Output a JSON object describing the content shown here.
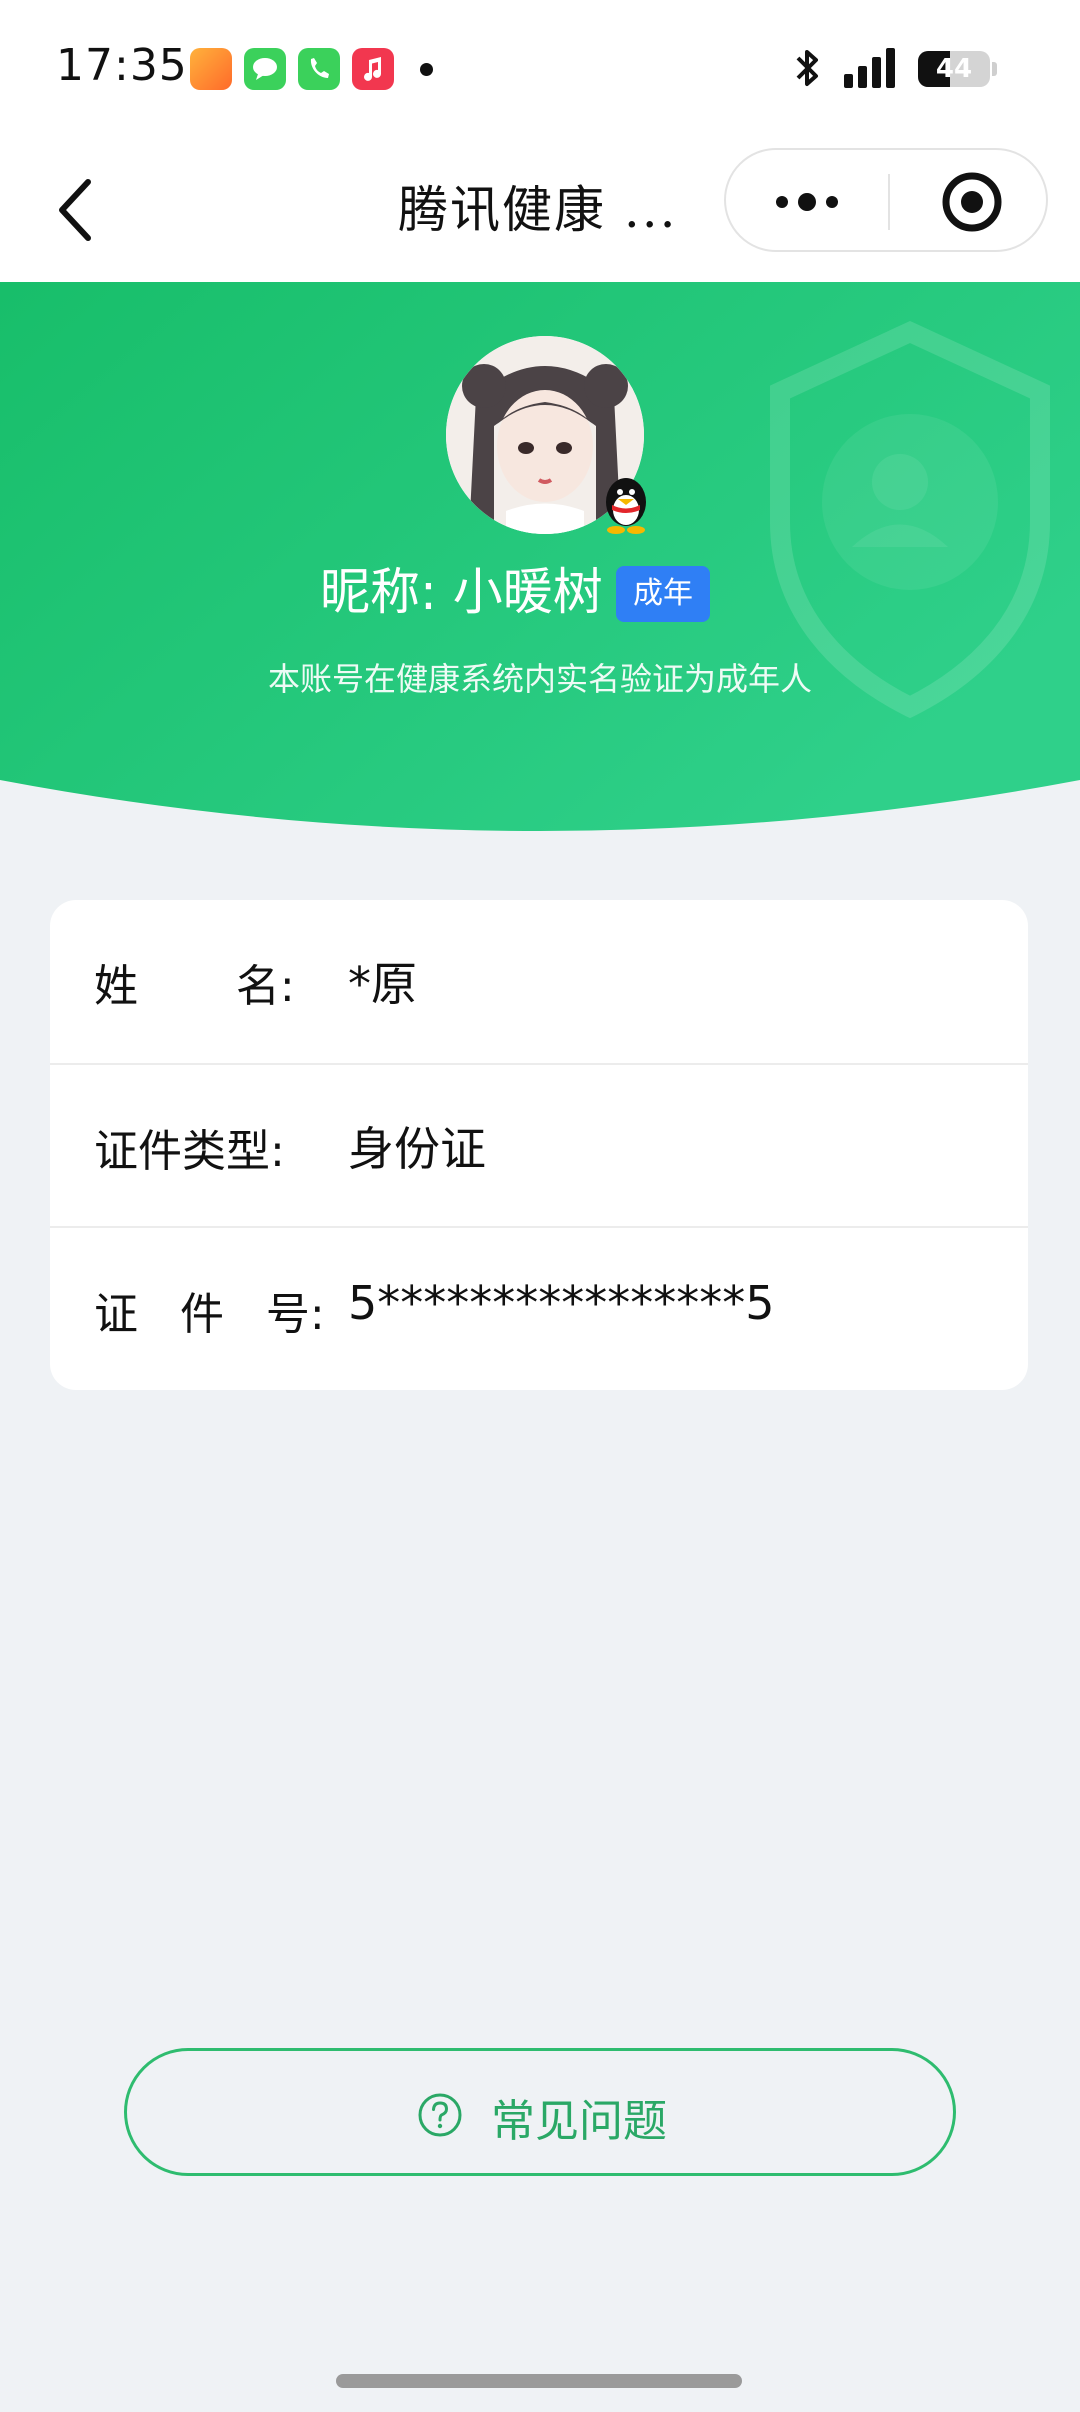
{
  "status_bar": {
    "time": "17:35",
    "battery_level": "44",
    "battery_fraction": 0.44,
    "icons": [
      "game-app-icon",
      "messages-icon",
      "phone-icon",
      "music-icon",
      "bluetooth-icon",
      "signal-icon",
      "battery-icon"
    ]
  },
  "nav": {
    "title": "腾讯健康 ...",
    "icons": [
      "back-icon",
      "more-icon",
      "target-icon"
    ]
  },
  "header": {
    "nickname": "昵称: 小暖树",
    "badge": "成年",
    "verify_text": "本账号在健康系统内实名验证为成年人",
    "icons": [
      "avatar",
      "qq-penguin-icon",
      "shield-icon"
    ],
    "colors": {
      "gradient_start": "#18be6a",
      "gradient_end": "#2fd08a",
      "badge": "#2f7ff5"
    }
  },
  "info": {
    "rows": [
      {
        "label": "姓       名:",
        "value": "*原"
      },
      {
        "label": "证件类型:",
        "value": "身份证"
      },
      {
        "label": "证   件   号:",
        "value": "5****************5"
      }
    ]
  },
  "faq": {
    "label": "常见问题",
    "icon": "question-circle-icon",
    "color": "#2ebc6f"
  }
}
